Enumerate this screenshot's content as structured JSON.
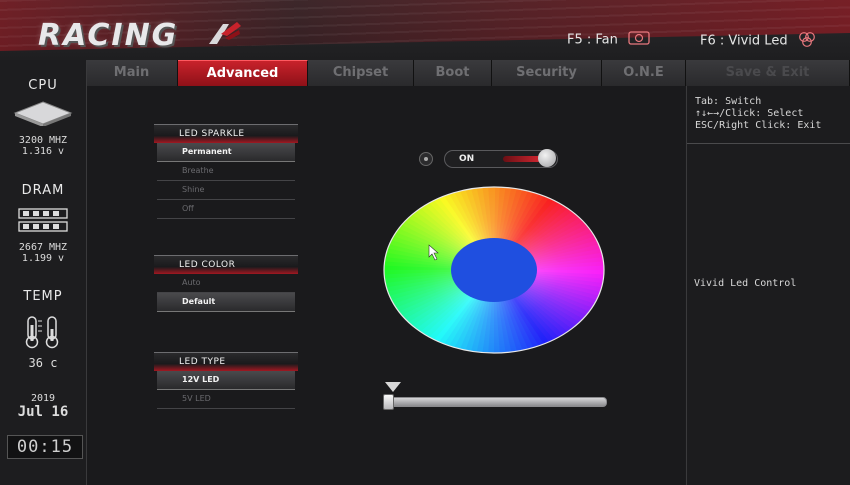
{
  "header": {
    "logo_text": "RACING",
    "hotkeys": [
      {
        "label": "F5 : Fan",
        "icon": "fan-icon"
      },
      {
        "label": "F6 : Vivid Led",
        "icon": "led-icon"
      }
    ]
  },
  "tabs": [
    {
      "label": "Main",
      "active": false
    },
    {
      "label": "Advanced",
      "active": true
    },
    {
      "label": "Chipset",
      "active": false
    },
    {
      "label": "Boot",
      "active": false
    },
    {
      "label": "Security",
      "active": false
    },
    {
      "label": "O.N.E",
      "active": false
    },
    {
      "label": "Save & Exit",
      "active": false
    }
  ],
  "sidebar": {
    "cpu": {
      "label": "CPU",
      "freq": "3200 MHZ",
      "volt": "1.316 v",
      "icon": "cpu-chip-icon"
    },
    "dram": {
      "label": "DRAM",
      "freq": "2667 MHZ",
      "volt": "1.199 v",
      "icon": "memory-module-icon"
    },
    "temp": {
      "label": "TEMP",
      "value": "36 c",
      "icon": "thermometer-icon"
    },
    "date": {
      "year": "2019",
      "day": "Jul 16"
    },
    "clock": "00:15"
  },
  "led_sparkle": {
    "title": "LED SPARKLE",
    "options": [
      "Permanent",
      "Breathe",
      "Shine",
      "Off"
    ],
    "selected": "Permanent"
  },
  "led_color": {
    "title": "LED COLOR",
    "options": [
      "Auto",
      "Default"
    ],
    "selected": "Default"
  },
  "led_type": {
    "title": "LED TYPE",
    "options": [
      "12V LED",
      "5V LED"
    ],
    "selected": "12V LED"
  },
  "toggle": {
    "label": "ON",
    "state": "on"
  },
  "brightness": {
    "level": 0.0
  },
  "help": {
    "tab_line": "Tab: Switch",
    "select_line": "↑↓←→/Click: Select",
    "exit_line": "ESC/Right Click: Exit",
    "description": "Vivid Led Control"
  },
  "colors": {
    "accent": "#c8222b",
    "background": "#1b1b1d",
    "wheel_center": "#1f4fe0"
  }
}
